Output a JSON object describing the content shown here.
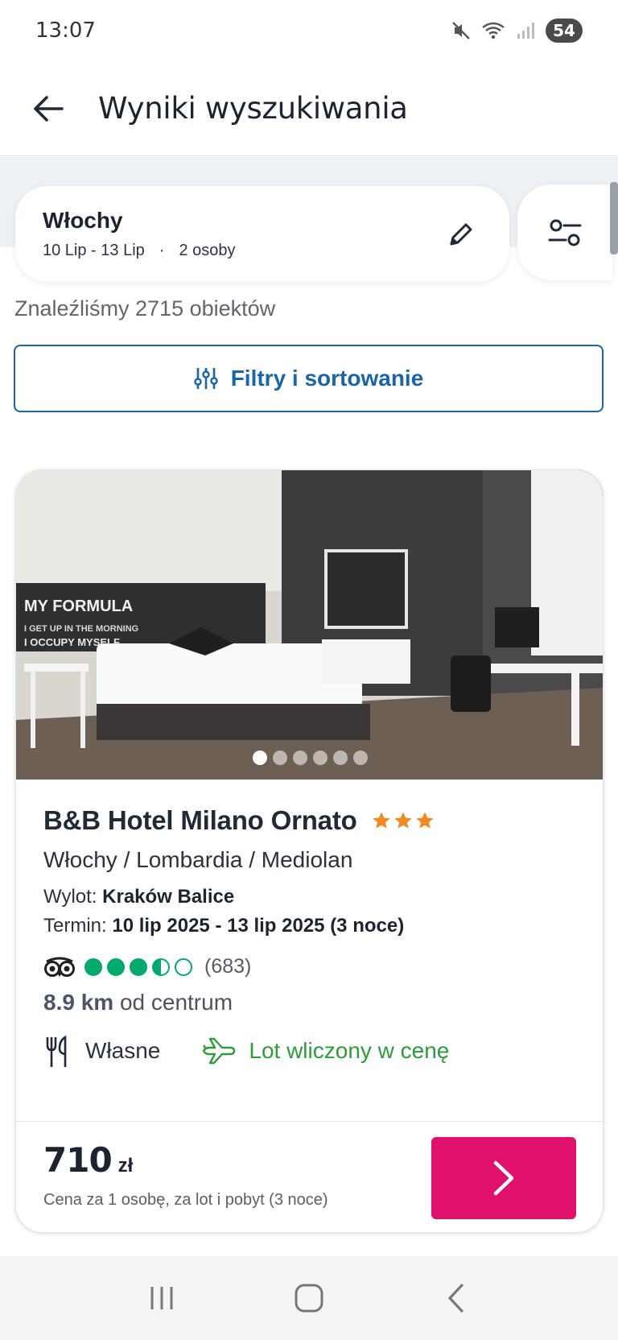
{
  "status_bar": {
    "time": "13:07",
    "battery": "54"
  },
  "header": {
    "title": "Wyniki wyszukiwania"
  },
  "search": {
    "destination": "Włochy",
    "dates": "10 Lip - 13 Lip",
    "separator": "·",
    "people": "2 osoby"
  },
  "results": {
    "found_text": "Znaleźliśmy 2715 obiektów",
    "filters_label": "Filtry i sortowanie"
  },
  "hotel": {
    "name": "B&B Hotel Milano Ornato",
    "stars": 3,
    "location": "Włochy / Lombardia / Mediolan",
    "departure_label": "Wylot:",
    "departure_value": "Kraków Balice",
    "term_label": "Termin:",
    "term_value": "10 lip 2025 - 13 lip 2025 (3 noce)",
    "rating_circles": 3.5,
    "review_count": "(683)",
    "distance_value": "8.9 km",
    "distance_label": "od centrum",
    "meal": "Własne",
    "flight": "Lot wliczony w cenę",
    "price": "710",
    "currency": "zł",
    "price_note": "Cena za 1 osobę, za lot i pobyt (3 noce)",
    "photo_count": 6,
    "photo_active": 1
  },
  "colors": {
    "accent_blue": "#1a64a8",
    "cta_pink": "#e0106f",
    "star": "#f08a24",
    "rating_green": "#00aa6c",
    "flight_green": "#2e9c3a"
  }
}
